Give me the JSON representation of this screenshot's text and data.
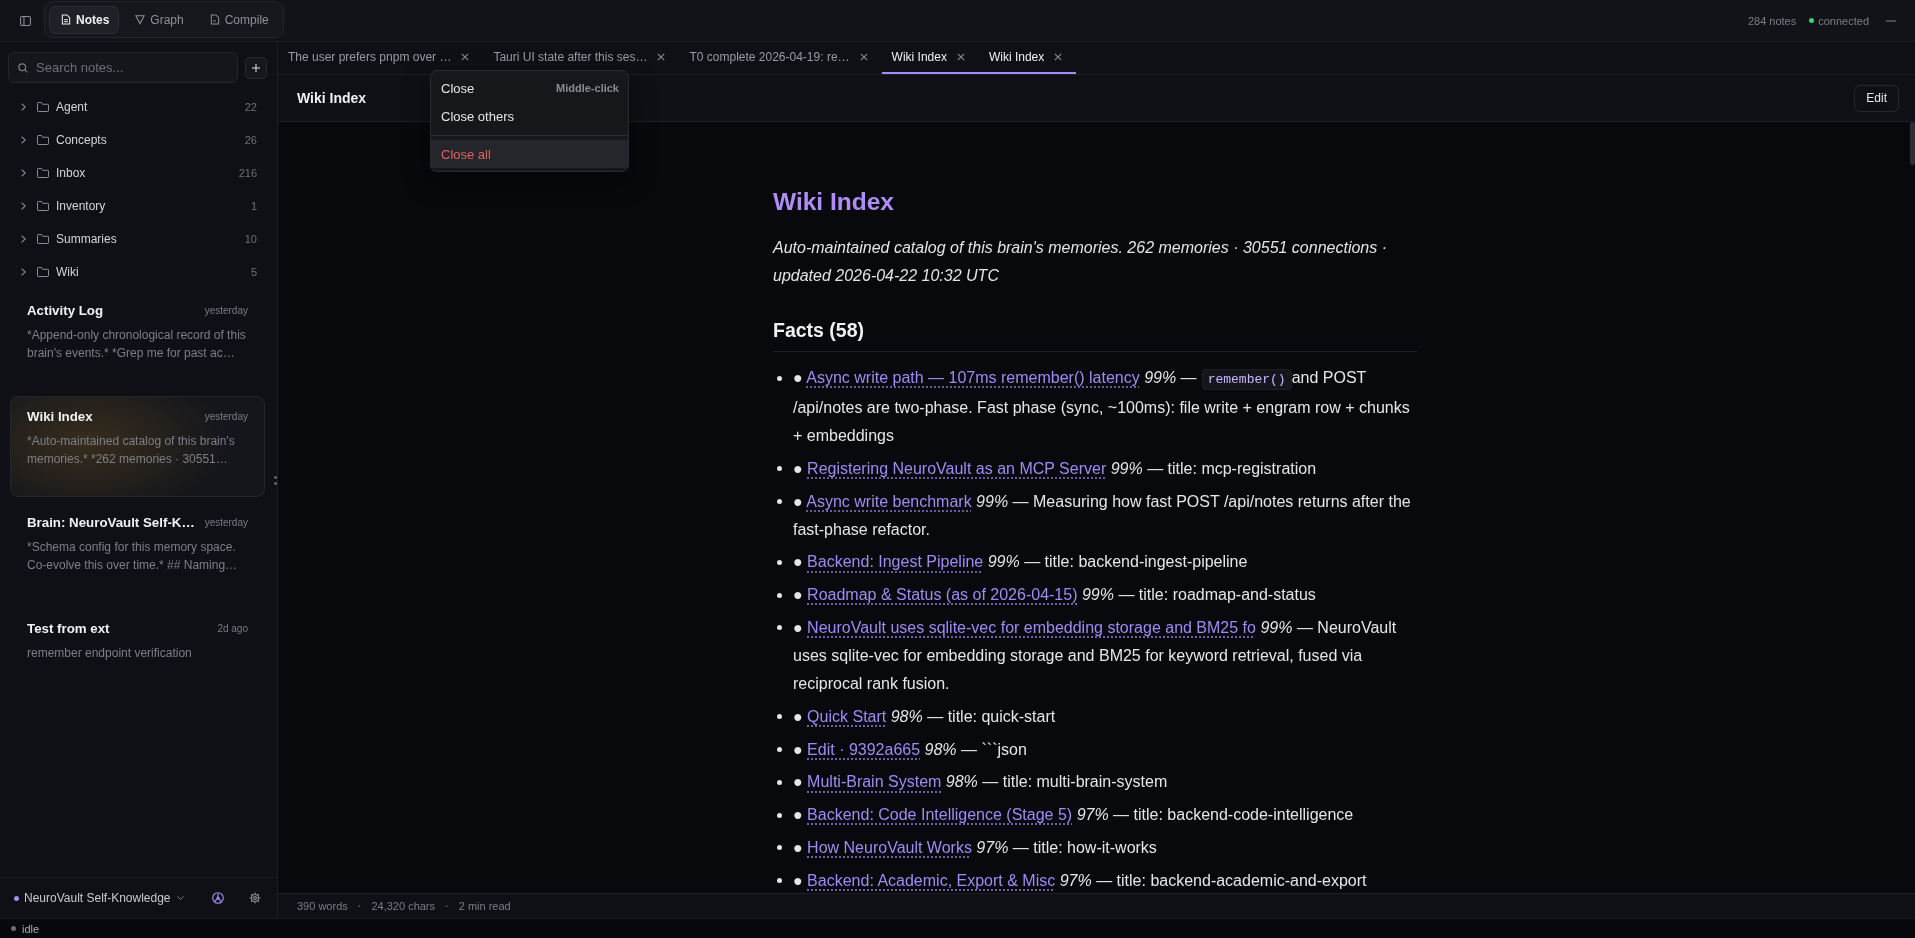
{
  "topbar": {
    "views": [
      {
        "kind": "notes",
        "label": "Notes",
        "selected": true
      },
      {
        "kind": "graph",
        "label": "Graph",
        "selected": false
      },
      {
        "kind": "compile",
        "label": "Compile",
        "selected": false
      }
    ],
    "note_count": "284 notes",
    "connection": "connected"
  },
  "sidebar": {
    "search": {
      "placeholder": "Search notes..."
    },
    "folders": [
      {
        "name": "Agent",
        "count": "22",
        "expanded": false
      },
      {
        "name": "Concepts",
        "count": "26",
        "expanded": false
      },
      {
        "name": "Inbox",
        "count": "216",
        "expanded": false
      },
      {
        "name": "Inventory",
        "count": "1",
        "expanded": false
      },
      {
        "name": "Summaries",
        "count": "10",
        "expanded": false
      },
      {
        "name": "Wiki",
        "count": "5",
        "expanded": false
      }
    ],
    "notes": [
      {
        "title": "Activity Log",
        "date": "yesterday",
        "preview": "*Append-only chronological record of this brain's events.* *Grep me for past ac…",
        "selected": false
      },
      {
        "title": "Wiki Index",
        "date": "yesterday",
        "preview": "*Auto-maintained catalog of this brain's memories.* *262 memories · 30551…",
        "selected": true
      },
      {
        "title": "Brain: NeuroVault Self-K…",
        "date": "yesterday",
        "preview": "*Schema config for this memory space. Co-evolve this over time.* ## Naming…",
        "selected": false
      },
      {
        "title": "Test from ext",
        "date": "2d ago",
        "preview": "remember endpoint verification",
        "selected": false
      }
    ],
    "brain": "NeuroVault Self-Knowledge"
  },
  "tabs": [
    {
      "label": "The user prefers pnpm over …",
      "selected": false
    },
    {
      "label": "Tauri UI state after this ses…",
      "selected": false
    },
    {
      "label": "T0 complete 2026-04-19: re…",
      "selected": false
    },
    {
      "label": "Wiki Index",
      "selected": true
    },
    {
      "label": "Wiki Index",
      "selected": true
    }
  ],
  "context_menu": {
    "items": [
      {
        "kind": "item",
        "label": "Close",
        "shortcut": "Middle-click",
        "highlighted": false
      },
      {
        "kind": "item",
        "label": "Close others",
        "highlighted": false
      },
      {
        "kind": "separator"
      },
      {
        "kind": "danger",
        "label": "Close all",
        "highlighted": true
      }
    ]
  },
  "note": {
    "title": "Wiki Index",
    "edit_button": "Edit"
  },
  "article": {
    "title": "Wiki Index",
    "intro": "Auto-maintained catalog of this brain's memories. 262 memories · 30551 connections · updated 2026-04-22 10:32 UTC",
    "section": "Facts (58)",
    "facts": [
      {
        "marker": "●",
        "link": "Async write path — 107ms remember() latency",
        "text": "*99%* —",
        "code": "remember()",
        "text_after": "and POST /api/notes are two-phase. Fast phase (sync, ~100ms): file write + engram row + chunks + embeddings"
      },
      {
        "marker": "●",
        "link": "Registering NeuroVault as an MCP Server",
        "text": "*99%* — title: mcp-registration"
      },
      {
        "marker": "●",
        "link": "Async write benchmark",
        "text": "*99%* — Measuring how fast POST /api/notes returns after the fast-phase refactor."
      },
      {
        "marker": "●",
        "link": "Backend: Ingest Pipeline",
        "text": "*99%* — title: backend-ingest-pipeline"
      },
      {
        "marker": "●",
        "link": "Roadmap & Status (as of 2026-04-15)",
        "text": "*99%* — title: roadmap-and-status"
      },
      {
        "marker": "●",
        "link": "NeuroVault uses sqlite-vec for embedding storage and BM25 fo",
        "text": "*99%* — NeuroVault uses sqlite-vec for embedding storage and BM25 for keyword retrieval, fused via reciprocal rank fusion."
      },
      {
        "marker": "●",
        "link": "Quick Start",
        "text": "*98%* — title: quick-start"
      },
      {
        "marker": "●",
        "link": "Edit · 9392a665",
        "text": "*98%* — ```json"
      },
      {
        "marker": "●",
        "link": "Multi-Brain System",
        "text": "*98%* — title: multi-brain-system"
      },
      {
        "marker": "●",
        "link": "Backend: Code Intelligence (Stage 5)",
        "text": "*97%* — title: backend-code-intelligence"
      },
      {
        "marker": "●",
        "link": "How NeuroVault Works",
        "text": "*97%* — title: how-it-works"
      },
      {
        "marker": "●",
        "link": "Backend: Academic, Export & Misc",
        "text": "*97%* — title: backend-academic-and-export"
      }
    ]
  },
  "word_stats": [
    {
      "kind": "stat",
      "text": "390 words"
    },
    {
      "kind": "separator",
      "text": "·"
    },
    {
      "kind": "stat",
      "text": "24,320 chars"
    },
    {
      "kind": "separator",
      "text": "·"
    },
    {
      "kind": "stat",
      "text": "2 min read"
    }
  ],
  "status_bar": {
    "state": "idle"
  }
}
